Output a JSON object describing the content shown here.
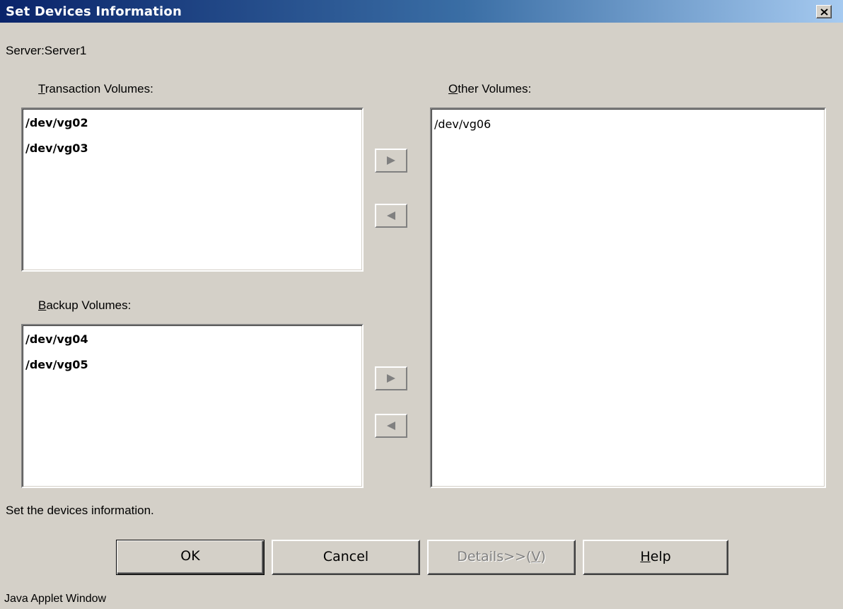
{
  "window": {
    "title": "Set Devices Information",
    "close_label": "×"
  },
  "server_label": "Server:Server1",
  "transaction": {
    "label_mnemonic": "T",
    "label_rest": "ransaction Volumes:",
    "items": [
      "/dev/vg02",
      "/dev/vg03"
    ]
  },
  "backup": {
    "label_mnemonic": "B",
    "label_rest": "ackup Volumes:",
    "items": [
      "/dev/vg04",
      "/dev/vg05"
    ]
  },
  "other": {
    "label_mnemonic": "O",
    "label_rest": "ther Volumes:",
    "items": [
      "/dev/vg06"
    ]
  },
  "status_text": "Set the devices information.",
  "buttons": {
    "ok": "OK",
    "cancel": "Cancel",
    "details_prefix": "Details>>(",
    "details_mnemonic": "V",
    "details_suffix": ")",
    "help_mnemonic": "H",
    "help_rest": "elp"
  },
  "footer": "Java Applet Window",
  "icons": {
    "arrow_right": "arrow-right-icon",
    "arrow_left": "arrow-left-icon",
    "close": "close-icon"
  },
  "colors": {
    "titlebar_start": "#0a246a",
    "titlebar_end": "#a6caf0",
    "dialog_bg": "#d4d0c8",
    "disabled_text": "#808080"
  }
}
